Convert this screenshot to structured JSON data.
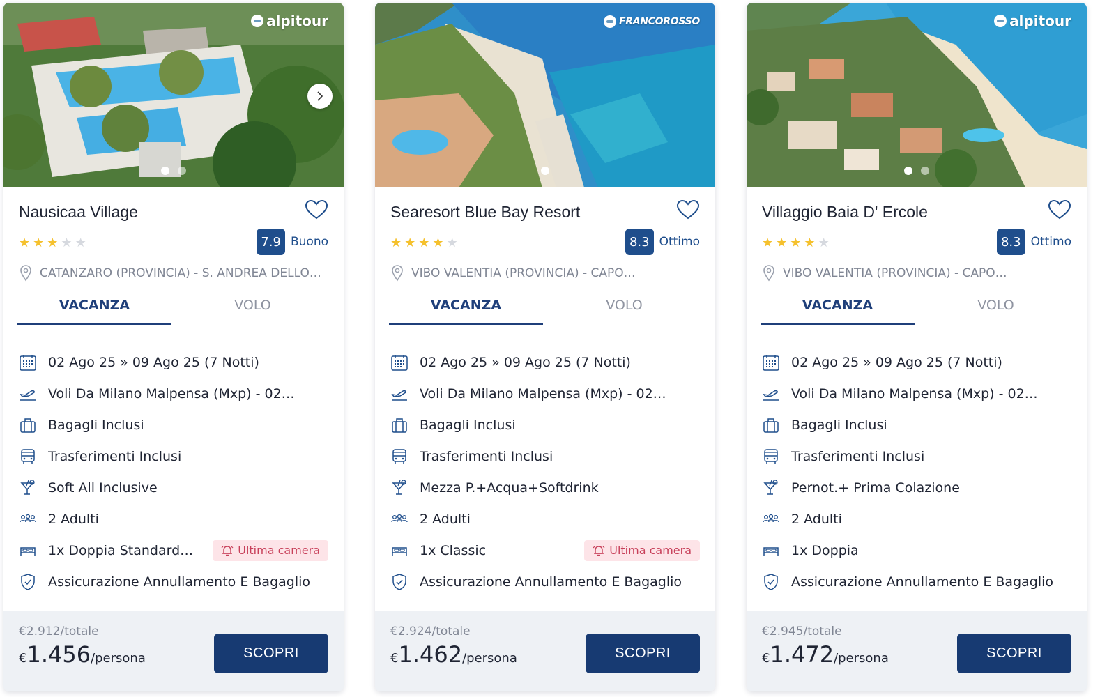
{
  "colors": {
    "primary": "#173a72",
    "score_badge": "#1f4e8c",
    "star_filled": "#f5c12e",
    "star_empty": "#d6d9df",
    "badge_bg": "#fde4e8",
    "badge_text": "#c8405a"
  },
  "cards": [
    {
      "brand": "alpitour",
      "name": "Nausicaa Village",
      "stars": 3,
      "star_max": 5,
      "score": "7.9",
      "score_label": "Buono",
      "location": "CATANZARO (PROVINCIA) - S. ANDREA DELLO…",
      "tabs": [
        "VACANZA",
        "VOLO"
      ],
      "features": [
        {
          "icon": "calendar-icon",
          "text": "02 Ago 25 » 09 Ago 25 (7 Notti)"
        },
        {
          "icon": "plane-icon",
          "text": "Voli Da Milano Malpensa (Mxp) - 02…"
        },
        {
          "icon": "luggage-icon",
          "text": "Bagagli Inclusi"
        },
        {
          "icon": "bus-icon",
          "text": "Trasferimenti Inclusi"
        },
        {
          "icon": "cocktail-icon",
          "text": "Soft All Inclusive"
        },
        {
          "icon": "people-icon",
          "text": "2 Adulti"
        },
        {
          "icon": "bed-icon",
          "text": "1x Doppia Standard…",
          "badge": "Ultima camera"
        },
        {
          "icon": "shield-icon",
          "text": "Assicurazione Annullamento E Bagaglio"
        }
      ],
      "price_total": "€2.912",
      "price_total_suffix": "/totale",
      "price_currency": "€",
      "price_per": "1.456",
      "price_per_suffix": "/persona",
      "cta": "SCOPRI"
    },
    {
      "brand": "FRANCOROSSO",
      "name": "Searesort Blue Bay Resort",
      "stars": 4,
      "star_max": 5,
      "score": "8.3",
      "score_label": "Ottimo",
      "location": "VIBO VALENTIA (PROVINCIA) - CAPO…",
      "tabs": [
        "VACANZA",
        "VOLO"
      ],
      "features": [
        {
          "icon": "calendar-icon",
          "text": "02 Ago 25 » 09 Ago 25 (7 Notti)"
        },
        {
          "icon": "plane-icon",
          "text": "Voli Da Milano Malpensa (Mxp) - 02…"
        },
        {
          "icon": "luggage-icon",
          "text": "Bagagli Inclusi"
        },
        {
          "icon": "bus-icon",
          "text": "Trasferimenti Inclusi"
        },
        {
          "icon": "cocktail-icon",
          "text": "Mezza P.+Acqua+Softdrink"
        },
        {
          "icon": "people-icon",
          "text": "2 Adulti"
        },
        {
          "icon": "bed-icon",
          "text": "1x Classic",
          "badge": "Ultima camera"
        },
        {
          "icon": "shield-icon",
          "text": "Assicurazione Annullamento E Bagaglio"
        }
      ],
      "price_total": "€2.924",
      "price_total_suffix": "/totale",
      "price_currency": "€",
      "price_per": "1.462",
      "price_per_suffix": "/persona",
      "cta": "SCOPRI"
    },
    {
      "brand": "alpitour",
      "name": "Villaggio Baia D' Ercole",
      "stars": 4,
      "star_max": 5,
      "score": "8.3",
      "score_label": "Ottimo",
      "location": "VIBO VALENTIA (PROVINCIA) - CAPO…",
      "tabs": [
        "VACANZA",
        "VOLO"
      ],
      "features": [
        {
          "icon": "calendar-icon",
          "text": "02 Ago 25 » 09 Ago 25 (7 Notti)"
        },
        {
          "icon": "plane-icon",
          "text": "Voli Da Milano Malpensa (Mxp) - 02…"
        },
        {
          "icon": "luggage-icon",
          "text": "Bagagli Inclusi"
        },
        {
          "icon": "bus-icon",
          "text": "Trasferimenti Inclusi"
        },
        {
          "icon": "cocktail-icon",
          "text": "Pernot.+ Prima Colazione"
        },
        {
          "icon": "people-icon",
          "text": "2 Adulti"
        },
        {
          "icon": "bed-icon",
          "text": "1x Doppia"
        },
        {
          "icon": "shield-icon",
          "text": "Assicurazione Annullamento E Bagaglio"
        }
      ],
      "price_total": "€2.945",
      "price_total_suffix": "/totale",
      "price_currency": "€",
      "price_per": "1.472",
      "price_per_suffix": "/persona",
      "cta": "SCOPRI"
    }
  ]
}
